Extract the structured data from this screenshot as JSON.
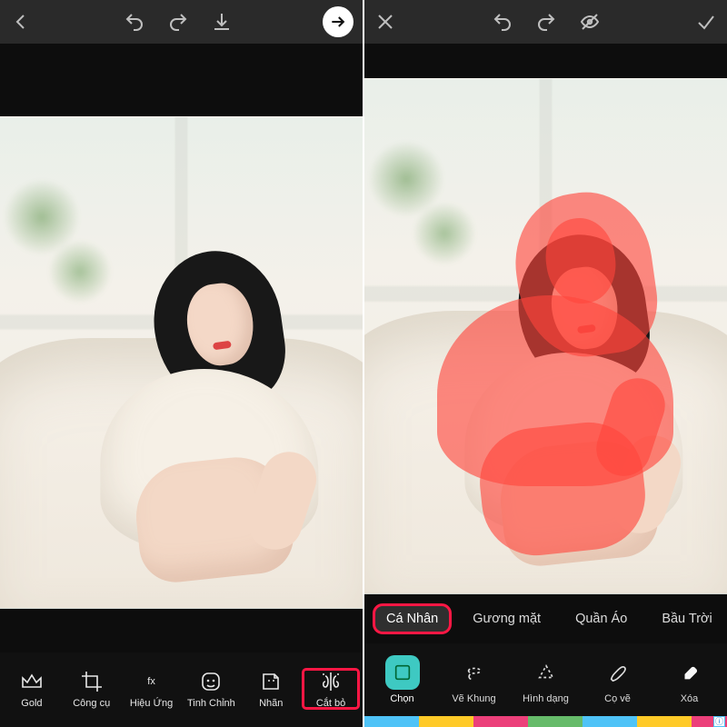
{
  "colors": {
    "accent": "#3ec9c2",
    "highlight": "#ff1744"
  },
  "left": {
    "topbar": {
      "back_icon": "chevron-left",
      "undo_icon": "undo",
      "redo_icon": "redo",
      "download_icon": "download",
      "next_icon": "arrow-right"
    },
    "tools": [
      {
        "key": "gold",
        "label": "Gold",
        "icon": "crown"
      },
      {
        "key": "congcu",
        "label": "Công cụ",
        "icon": "crop"
      },
      {
        "key": "hieuung",
        "label": "Hiệu Ứng",
        "icon": "fx"
      },
      {
        "key": "tinhchinh",
        "label": "Tinh Chỉnh",
        "icon": "face-adjust"
      },
      {
        "key": "nhan",
        "label": "Nhãn",
        "icon": "sticker"
      },
      {
        "key": "catbo",
        "label": "Cắt bỏ",
        "icon": "cutout",
        "highlighted": true
      }
    ]
  },
  "right": {
    "topbar": {
      "close_icon": "close",
      "undo_icon": "undo",
      "redo_icon": "redo",
      "preview_icon": "eye-off",
      "confirm_icon": "check"
    },
    "chips": [
      {
        "key": "canhan",
        "label": "Cá Nhân",
        "selected": true,
        "highlighted": true
      },
      {
        "key": "guongmat",
        "label": "Gương mặt",
        "selected": false
      },
      {
        "key": "quanao",
        "label": "Quần Áo",
        "selected": false
      },
      {
        "key": "bautroi",
        "label": "Bầu Trời",
        "selected": false
      }
    ],
    "draw_tools": [
      {
        "key": "chon",
        "label": "Chọn",
        "icon": "auto-select",
        "active": true
      },
      {
        "key": "vekhung",
        "label": "Vẽ Khung",
        "icon": "lasso"
      },
      {
        "key": "hinhdang",
        "label": "Hình dạng",
        "icon": "shape-dashed"
      },
      {
        "key": "cove",
        "label": "Cọ vẽ",
        "icon": "brush"
      },
      {
        "key": "xoa",
        "label": "Xóa",
        "icon": "eraser"
      }
    ]
  }
}
